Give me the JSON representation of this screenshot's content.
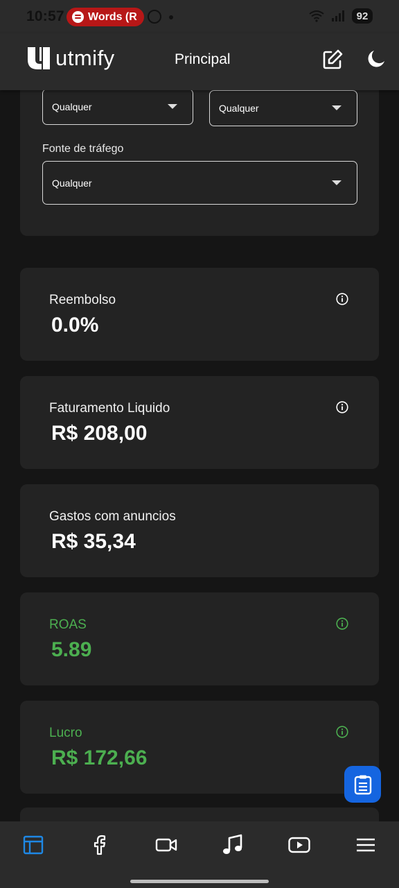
{
  "status_bar": {
    "time": "10:57",
    "media_pill": "Words (R",
    "battery": "92",
    "pill_color": "#b71717"
  },
  "header": {
    "logo_text": "utmify",
    "title": "Principal",
    "icons": [
      "edit-icon",
      "moon-icon"
    ]
  },
  "filters": {
    "select_1_value": "Qualquer",
    "select_2_value": "Qualquer",
    "traffic_source_label": "Fonte de tráfego",
    "traffic_source_value": "Qualquer"
  },
  "metrics": [
    {
      "label": "Reembolso",
      "value": "0.0%",
      "color": "#ffffff"
    },
    {
      "label": "Faturamento Liquido",
      "value": "R$ 208,00",
      "color": "#ffffff"
    },
    {
      "label": "Gastos com anuncios",
      "value": "R$ 35,34",
      "color": "#ffffff"
    },
    {
      "label": "ROAS",
      "value": "5.89",
      "color": "#4caf50"
    },
    {
      "label": "Lucro",
      "value": "R$ 172,66",
      "color": "#4caf50"
    }
  ],
  "fab": {
    "icon": "clipboard-icon",
    "color": "#1565e0"
  },
  "bottom_nav": {
    "items": [
      "dashboard-icon",
      "facebook-icon",
      "video-icon",
      "music-icon",
      "youtube-icon",
      "menu-icon"
    ],
    "active_color": "#1e88e5"
  }
}
